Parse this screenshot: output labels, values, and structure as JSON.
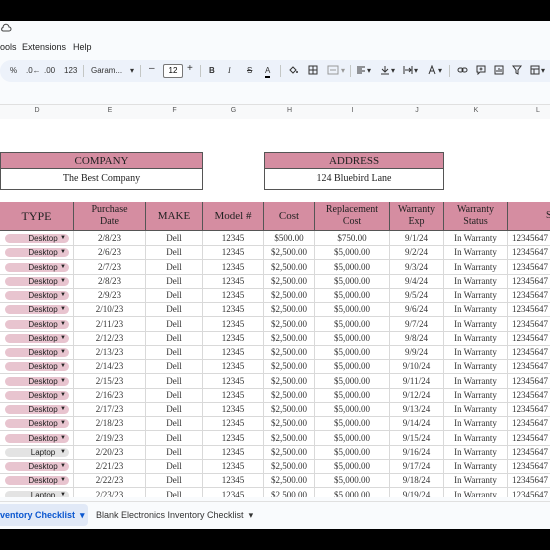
{
  "menubar": {
    "items": [
      "ools",
      "Extensions",
      "Help"
    ]
  },
  "toolbar": {
    "percent": "%",
    "dec_decrease": ".0←",
    "dec_increase": ".00",
    "number_format": "123",
    "font": "Garam...",
    "minus": "–",
    "font_size": "12",
    "plus": "+",
    "bold": "B",
    "italic": "I",
    "strike": "S",
    "text_color": "A"
  },
  "columns": [
    "D",
    "E",
    "F",
    "G",
    "H",
    "I",
    "J",
    "K",
    "L"
  ],
  "company": {
    "label": "COMPANY",
    "value": "The Best Company"
  },
  "address": {
    "label": "ADDRESS",
    "value": "124 Bluebird Lane"
  },
  "table": {
    "headers": [
      "TYPE",
      "Purchase\nDate",
      "MAKE",
      "Model #",
      "Cost",
      "Replacement\nCost",
      "Warranty\nExp",
      "Warranty\nStatus",
      "Ser"
    ],
    "rows": [
      [
        "Desktop",
        "2/8/23",
        "Dell",
        "12345",
        "$500.00",
        "$750.00",
        "9/1/24",
        "In Warranty",
        "12345647"
      ],
      [
        "Desktop",
        "2/6/23",
        "Dell",
        "12345",
        "$2,500.00",
        "$5,000.00",
        "9/2/24",
        "In Warranty",
        "12345647"
      ],
      [
        "Desktop",
        "2/7/23",
        "Dell",
        "12345",
        "$2,500.00",
        "$5,000.00",
        "9/3/24",
        "In Warranty",
        "12345647"
      ],
      [
        "Desktop",
        "2/8/23",
        "Dell",
        "12345",
        "$2,500.00",
        "$5,000.00",
        "9/4/24",
        "In Warranty",
        "12345647"
      ],
      [
        "Desktop",
        "2/9/23",
        "Dell",
        "12345",
        "$2,500.00",
        "$5,000.00",
        "9/5/24",
        "In Warranty",
        "12345647"
      ],
      [
        "Desktop",
        "2/10/23",
        "Dell",
        "12345",
        "$2,500.00",
        "$5,000.00",
        "9/6/24",
        "In Warranty",
        "12345647"
      ],
      [
        "Desktop",
        "2/11/23",
        "Dell",
        "12345",
        "$2,500.00",
        "$5,000.00",
        "9/7/24",
        "In Warranty",
        "12345647"
      ],
      [
        "Desktop",
        "2/12/23",
        "Dell",
        "12345",
        "$2,500.00",
        "$5,000.00",
        "9/8/24",
        "In Warranty",
        "12345647"
      ],
      [
        "Desktop",
        "2/13/23",
        "Dell",
        "12345",
        "$2,500.00",
        "$5,000.00",
        "9/9/24",
        "In Warranty",
        "12345647"
      ],
      [
        "Desktop",
        "2/14/23",
        "Dell",
        "12345",
        "$2,500.00",
        "$5,000.00",
        "9/10/24",
        "In Warranty",
        "12345647"
      ],
      [
        "Desktop",
        "2/15/23",
        "Dell",
        "12345",
        "$2,500.00",
        "$5,000.00",
        "9/11/24",
        "In Warranty",
        "12345647"
      ],
      [
        "Desktop",
        "2/16/23",
        "Dell",
        "12345",
        "$2,500.00",
        "$5,000.00",
        "9/12/24",
        "In Warranty",
        "12345647"
      ],
      [
        "Desktop",
        "2/17/23",
        "Dell",
        "12345",
        "$2,500.00",
        "$5,000.00",
        "9/13/24",
        "In Warranty",
        "12345647"
      ],
      [
        "Desktop",
        "2/18/23",
        "Dell",
        "12345",
        "$2,500.00",
        "$5,000.00",
        "9/14/24",
        "In Warranty",
        "12345647"
      ],
      [
        "Desktop",
        "2/19/23",
        "Dell",
        "12345",
        "$2,500.00",
        "$5,000.00",
        "9/15/24",
        "In Warranty",
        "12345647"
      ],
      [
        "Laptop",
        "2/20/23",
        "Dell",
        "12345",
        "$2,500.00",
        "$5,000.00",
        "9/16/24",
        "In Warranty",
        "12345647"
      ],
      [
        "Desktop",
        "2/21/23",
        "Dell",
        "12345",
        "$2,500.00",
        "$5,000.00",
        "9/17/24",
        "In Warranty",
        "12345647"
      ],
      [
        "Desktop",
        "2/22/23",
        "Dell",
        "12345",
        "$2,500.00",
        "$5,000.00",
        "9/18/24",
        "In Warranty",
        "12345647"
      ],
      [
        "Laptop",
        "2/23/23",
        "Dell",
        "12345",
        "$2,500.00",
        "$5,000.00",
        "9/19/24",
        "In Warranty",
        "12345647"
      ],
      [
        "Desktop",
        "2/24/23",
        "Dell",
        "12345",
        "$2,500.00",
        "$5,000.00",
        "9/20/24",
        "In Warranty",
        "12345647"
      ]
    ]
  },
  "chip_colors": {
    "Desktop": "#e8c4cf",
    "Laptop": "#e3e3e3"
  },
  "tabs": {
    "active": "ventory Checklist",
    "other": "Blank Electronics Inventory Checklist"
  }
}
